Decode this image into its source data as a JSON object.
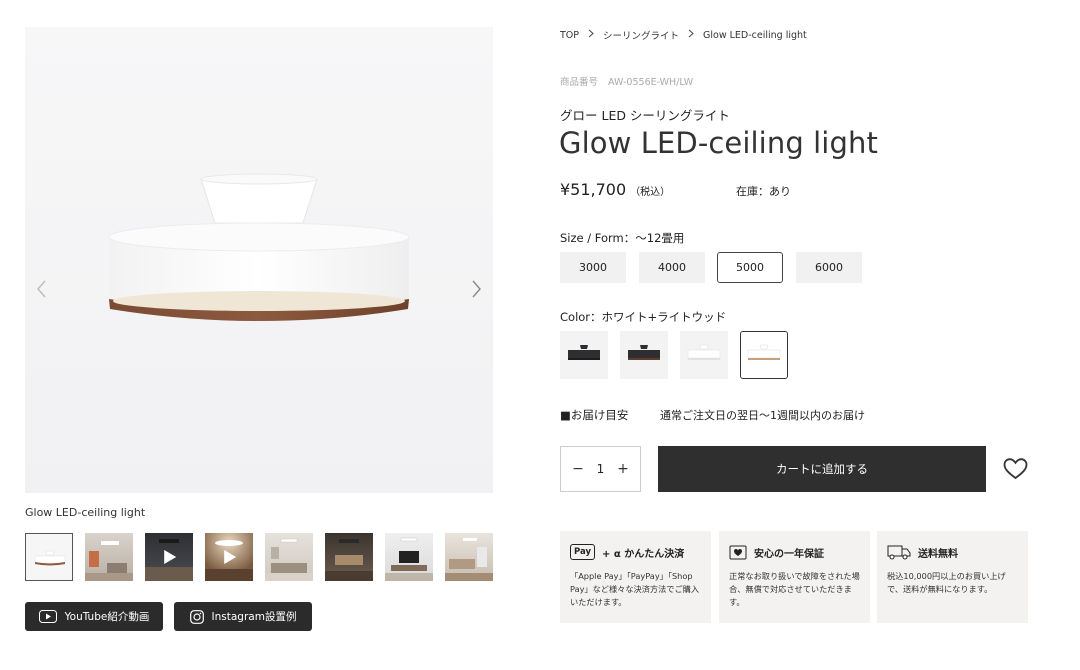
{
  "gallery": {
    "caption": "Glow LED-ceiling light",
    "thumbnails": [
      {
        "label": "lamp-front",
        "video": false,
        "active": true
      },
      {
        "label": "room-scene-1",
        "video": false,
        "active": false
      },
      {
        "label": "video-1",
        "video": true,
        "active": false
      },
      {
        "label": "video-2",
        "video": true,
        "active": false
      },
      {
        "label": "room-scene-2",
        "video": false,
        "active": false
      },
      {
        "label": "room-scene-3",
        "video": false,
        "active": false
      },
      {
        "label": "room-scene-4",
        "video": false,
        "active": false
      },
      {
        "label": "room-scene-5",
        "video": false,
        "active": false
      }
    ],
    "youtube_label": "YouTube紹介動画",
    "instagram_label": "Instagram設置例"
  },
  "breadcrumb": {
    "items": [
      "TOP",
      "シーリングライト",
      "Glow LED-ceiling light"
    ]
  },
  "product": {
    "code_label": "商品番号",
    "code_value": "AW-0556E-WH/LW",
    "subtitle": "グロー LED シーリングライト",
    "title": "Glow LED-ceiling light",
    "price": "¥51,700",
    "tax_note": "（税込）",
    "stock": "在庫：あり",
    "size_label": "Size / Form：〜12畳用",
    "sizes": [
      "3000",
      "4000",
      "5000",
      "6000"
    ],
    "selected_size": "5000",
    "color_label": "Color：ホワイト+ライトウッド",
    "colors": [
      {
        "name": "black-black",
        "shade": "#2e2e30",
        "rim": "#1c1c1c"
      },
      {
        "name": "black-darkwood",
        "shade": "#2e2e30",
        "rim": "#5b3e2b"
      },
      {
        "name": "white-white",
        "shade": "#f4f4f4",
        "rim": "#e2e2e2"
      },
      {
        "name": "white-lightwood",
        "shade": "#f7f7f7",
        "rim": "#c7a07a"
      }
    ],
    "selected_color": "white-lightwood",
    "delivery_label": "■お届け目安",
    "delivery_value": "通常ご注文日の翌日〜1週間以内のお届け",
    "quantity": "1",
    "cart_label": "カートに追加する"
  },
  "features": [
    {
      "icon": "applepay-icon",
      "badge": "Pay",
      "head": "+ α  かんたん決済",
      "text": "「Apple Pay」「PayPay」「Shop Pay」など様々な決済方法でご購入いただけます。"
    },
    {
      "icon": "shield-heart-icon",
      "head": "安心の一年保証",
      "text": "正常なお取り扱いで故障をされた場合、無償で対応させていただきます。"
    },
    {
      "icon": "truck-icon",
      "head": "送料無料",
      "text": "税込10,000円以上のお買い上げで、送料が無料になります。"
    }
  ]
}
